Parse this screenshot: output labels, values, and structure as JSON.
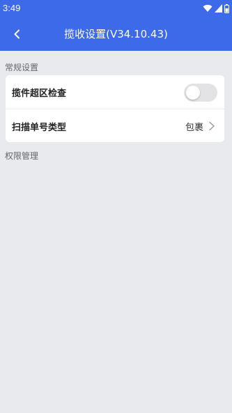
{
  "status_bar": {
    "time": "3:49",
    "icons": [
      "wifi-icon",
      "signal-icon",
      "battery-icon"
    ]
  },
  "header": {
    "back_icon": "chevron-left-icon",
    "title": "揽收设置(V34.10.43)"
  },
  "sections": {
    "general": {
      "label": "常规设置",
      "items": [
        {
          "label": "揽件超区检查",
          "control": "toggle",
          "value_on": false
        },
        {
          "label": "扫描单号类型",
          "control": "select",
          "value": "包裹",
          "icon": "chevron-right-icon"
        }
      ]
    },
    "permissions": {
      "label": "权限管理"
    }
  },
  "colors": {
    "primary": "#3d6ae8",
    "background": "#e9eaee",
    "card": "#ffffff",
    "toggle_off": "#e3e3e6"
  }
}
